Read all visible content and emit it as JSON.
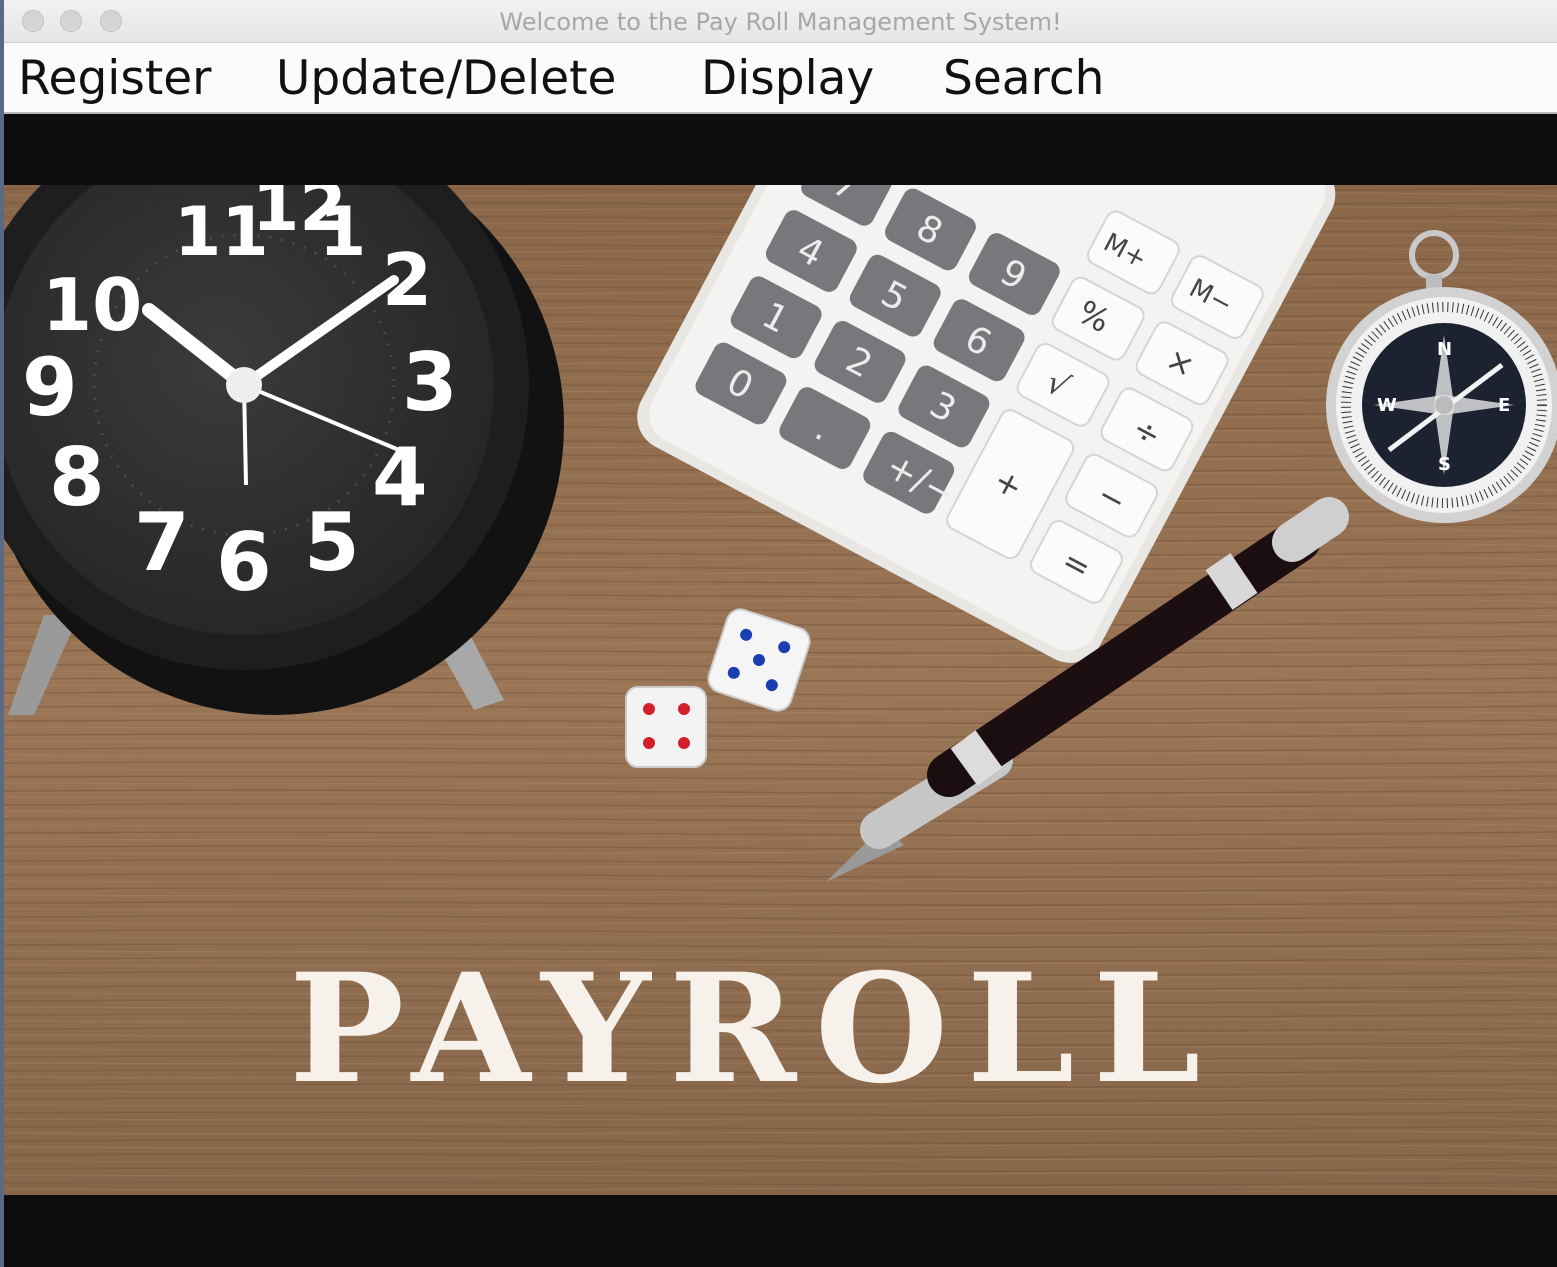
{
  "window": {
    "title": "Welcome to the Pay Roll Management System!"
  },
  "menu": {
    "items": [
      {
        "label": "Register"
      },
      {
        "label": "Update/Delete"
      },
      {
        "label": "Display"
      },
      {
        "label": "Search"
      }
    ]
  },
  "banner": {
    "text": "PAYROLL"
  },
  "colors": {
    "desk": "#8b6a4c",
    "clock": "#1b1b1b",
    "calculator": "#f2f1ef"
  },
  "icons": [
    "alarm-clock-icon",
    "calculator-icon",
    "compass-icon",
    "pen-icon",
    "dice-icon"
  ]
}
